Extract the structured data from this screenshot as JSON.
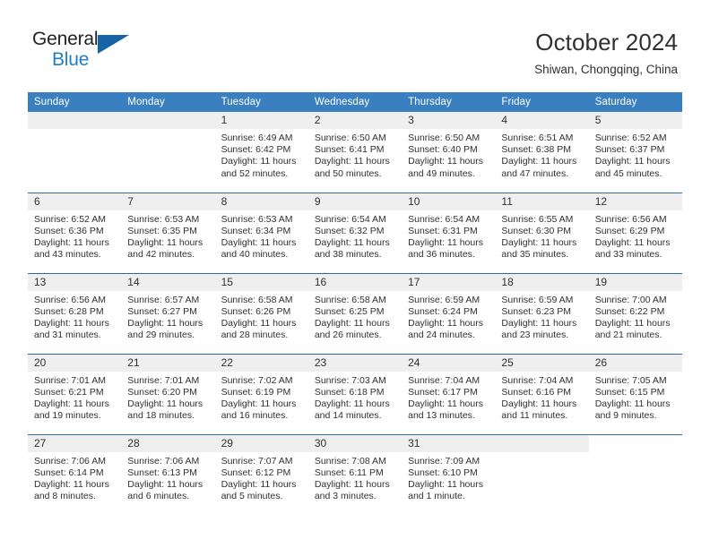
{
  "brand": {
    "name_top": "General",
    "name_bottom": "Blue",
    "triangle_color": "#1763a8",
    "blue_text_color": "#1f7ec4"
  },
  "header": {
    "title": "October 2024",
    "location": "Shiwan, Chongqing, China"
  },
  "theme": {
    "header_row_bg": "#3a7fbf",
    "row_separator": "#2e6da4",
    "daynum_strip_bg": "#efefef",
    "text": "#303030"
  },
  "weekday_headers": [
    "Sunday",
    "Monday",
    "Tuesday",
    "Wednesday",
    "Thursday",
    "Friday",
    "Saturday"
  ],
  "weeks": [
    [
      {
        "day": "",
        "sunrise": "",
        "sunset": "",
        "daylight": "",
        "blank": true,
        "strip": true
      },
      {
        "day": "",
        "sunrise": "",
        "sunset": "",
        "daylight": "",
        "blank": true,
        "strip": true
      },
      {
        "day": "1",
        "sunrise": "Sunrise: 6:49 AM",
        "sunset": "Sunset: 6:42 PM",
        "daylight": "Daylight: 11 hours and 52 minutes."
      },
      {
        "day": "2",
        "sunrise": "Sunrise: 6:50 AM",
        "sunset": "Sunset: 6:41 PM",
        "daylight": "Daylight: 11 hours and 50 minutes."
      },
      {
        "day": "3",
        "sunrise": "Sunrise: 6:50 AM",
        "sunset": "Sunset: 6:40 PM",
        "daylight": "Daylight: 11 hours and 49 minutes."
      },
      {
        "day": "4",
        "sunrise": "Sunrise: 6:51 AM",
        "sunset": "Sunset: 6:38 PM",
        "daylight": "Daylight: 11 hours and 47 minutes."
      },
      {
        "day": "5",
        "sunrise": "Sunrise: 6:52 AM",
        "sunset": "Sunset: 6:37 PM",
        "daylight": "Daylight: 11 hours and 45 minutes."
      }
    ],
    [
      {
        "day": "6",
        "sunrise": "Sunrise: 6:52 AM",
        "sunset": "Sunset: 6:36 PM",
        "daylight": "Daylight: 11 hours and 43 minutes."
      },
      {
        "day": "7",
        "sunrise": "Sunrise: 6:53 AM",
        "sunset": "Sunset: 6:35 PM",
        "daylight": "Daylight: 11 hours and 42 minutes."
      },
      {
        "day": "8",
        "sunrise": "Sunrise: 6:53 AM",
        "sunset": "Sunset: 6:34 PM",
        "daylight": "Daylight: 11 hours and 40 minutes."
      },
      {
        "day": "9",
        "sunrise": "Sunrise: 6:54 AM",
        "sunset": "Sunset: 6:32 PM",
        "daylight": "Daylight: 11 hours and 38 minutes."
      },
      {
        "day": "10",
        "sunrise": "Sunrise: 6:54 AM",
        "sunset": "Sunset: 6:31 PM",
        "daylight": "Daylight: 11 hours and 36 minutes."
      },
      {
        "day": "11",
        "sunrise": "Sunrise: 6:55 AM",
        "sunset": "Sunset: 6:30 PM",
        "daylight": "Daylight: 11 hours and 35 minutes."
      },
      {
        "day": "12",
        "sunrise": "Sunrise: 6:56 AM",
        "sunset": "Sunset: 6:29 PM",
        "daylight": "Daylight: 11 hours and 33 minutes."
      }
    ],
    [
      {
        "day": "13",
        "sunrise": "Sunrise: 6:56 AM",
        "sunset": "Sunset: 6:28 PM",
        "daylight": "Daylight: 11 hours and 31 minutes."
      },
      {
        "day": "14",
        "sunrise": "Sunrise: 6:57 AM",
        "sunset": "Sunset: 6:27 PM",
        "daylight": "Daylight: 11 hours and 29 minutes."
      },
      {
        "day": "15",
        "sunrise": "Sunrise: 6:58 AM",
        "sunset": "Sunset: 6:26 PM",
        "daylight": "Daylight: 11 hours and 28 minutes."
      },
      {
        "day": "16",
        "sunrise": "Sunrise: 6:58 AM",
        "sunset": "Sunset: 6:25 PM",
        "daylight": "Daylight: 11 hours and 26 minutes."
      },
      {
        "day": "17",
        "sunrise": "Sunrise: 6:59 AM",
        "sunset": "Sunset: 6:24 PM",
        "daylight": "Daylight: 11 hours and 24 minutes."
      },
      {
        "day": "18",
        "sunrise": "Sunrise: 6:59 AM",
        "sunset": "Sunset: 6:23 PM",
        "daylight": "Daylight: 11 hours and 23 minutes."
      },
      {
        "day": "19",
        "sunrise": "Sunrise: 7:00 AM",
        "sunset": "Sunset: 6:22 PM",
        "daylight": "Daylight: 11 hours and 21 minutes."
      }
    ],
    [
      {
        "day": "20",
        "sunrise": "Sunrise: 7:01 AM",
        "sunset": "Sunset: 6:21 PM",
        "daylight": "Daylight: 11 hours and 19 minutes."
      },
      {
        "day": "21",
        "sunrise": "Sunrise: 7:01 AM",
        "sunset": "Sunset: 6:20 PM",
        "daylight": "Daylight: 11 hours and 18 minutes."
      },
      {
        "day": "22",
        "sunrise": "Sunrise: 7:02 AM",
        "sunset": "Sunset: 6:19 PM",
        "daylight": "Daylight: 11 hours and 16 minutes."
      },
      {
        "day": "23",
        "sunrise": "Sunrise: 7:03 AM",
        "sunset": "Sunset: 6:18 PM",
        "daylight": "Daylight: 11 hours and 14 minutes."
      },
      {
        "day": "24",
        "sunrise": "Sunrise: 7:04 AM",
        "sunset": "Sunset: 6:17 PM",
        "daylight": "Daylight: 11 hours and 13 minutes."
      },
      {
        "day": "25",
        "sunrise": "Sunrise: 7:04 AM",
        "sunset": "Sunset: 6:16 PM",
        "daylight": "Daylight: 11 hours and 11 minutes."
      },
      {
        "day": "26",
        "sunrise": "Sunrise: 7:05 AM",
        "sunset": "Sunset: 6:15 PM",
        "daylight": "Daylight: 11 hours and 9 minutes."
      }
    ],
    [
      {
        "day": "27",
        "sunrise": "Sunrise: 7:06 AM",
        "sunset": "Sunset: 6:14 PM",
        "daylight": "Daylight: 11 hours and 8 minutes."
      },
      {
        "day": "28",
        "sunrise": "Sunrise: 7:06 AM",
        "sunset": "Sunset: 6:13 PM",
        "daylight": "Daylight: 11 hours and 6 minutes."
      },
      {
        "day": "29",
        "sunrise": "Sunrise: 7:07 AM",
        "sunset": "Sunset: 6:12 PM",
        "daylight": "Daylight: 11 hours and 5 minutes."
      },
      {
        "day": "30",
        "sunrise": "Sunrise: 7:08 AM",
        "sunset": "Sunset: 6:11 PM",
        "daylight": "Daylight: 11 hours and 3 minutes."
      },
      {
        "day": "31",
        "sunrise": "Sunrise: 7:09 AM",
        "sunset": "Sunset: 6:10 PM",
        "daylight": "Daylight: 11 hours and 1 minute."
      },
      {
        "day": "",
        "sunrise": "",
        "sunset": "",
        "daylight": "",
        "blank": true,
        "strip": true
      },
      {
        "day": "",
        "sunrise": "",
        "sunset": "",
        "daylight": "",
        "blank": true,
        "strip": false
      }
    ]
  ]
}
